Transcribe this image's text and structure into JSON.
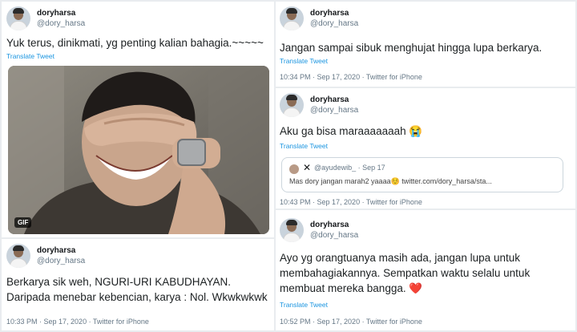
{
  "tweets": [
    {
      "name": "doryharsa",
      "handle": "@dory_harsa",
      "text": "Yuk terus, dinikmati, yg penting kalian bahagia.~~~~~",
      "translate": "Translate Tweet",
      "gif_badge": "GIF"
    },
    {
      "name": "doryharsa",
      "handle": "@dory_harsa",
      "text": "Berkarya sik weh, NGURI-URI KABUDHAYAN. Daripada menebar kebencian, karya : Nol. Wkwkwkwk",
      "meta": "10:33 PM · Sep 17, 2020 · Twitter for iPhone"
    },
    {
      "name": "doryharsa",
      "handle": "@dory_harsa",
      "text": "Jangan sampai sibuk menghujat hingga lupa berkarya.",
      "translate": "Translate Tweet",
      "meta": "10:34 PM · Sep 17, 2020 · Twitter for iPhone"
    },
    {
      "name": "doryharsa",
      "handle": "@dory_harsa",
      "text": "Aku ga bisa maraaaaaaah 😭",
      "translate": "Translate Tweet",
      "quote": {
        "separator": "✕",
        "handle": "@ayudewib_ · Sep 17",
        "text": "Mas dory jangan marah2 yaaaa☺️ twitter.com/dory_harsa/sta..."
      },
      "meta": "10:43 PM · Sep 17, 2020 · Twitter for iPhone"
    },
    {
      "name": "doryharsa",
      "handle": "@dory_harsa",
      "text": "Ayo yg orangtuanya masih ada, jangan lupa untuk membahagiakannya. Sempatkan waktu selalu untuk membuat mereka bangga.",
      "emoji": "❤️",
      "translate": "Translate Tweet",
      "meta": "10:52 PM · Sep 17, 2020 · Twitter for iPhone"
    }
  ],
  "colors": {
    "link": "#1b95e0",
    "muted": "#657786",
    "heart": "#e0245e"
  }
}
